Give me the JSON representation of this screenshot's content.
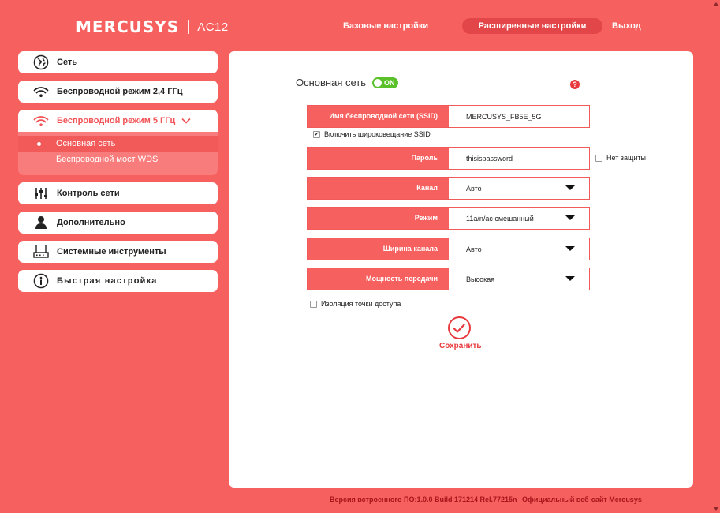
{
  "header": {
    "brand": "MERCUSYS",
    "model": "AC12",
    "nav": {
      "basic": "Базовые настройки",
      "advanced": "Расширенные настройки",
      "exit": "Выход"
    }
  },
  "sidebar": {
    "items": [
      {
        "label": "Сеть",
        "icon": "globe-icon"
      },
      {
        "label": "Беспроводной режим 2,4 ГГц",
        "icon": "wifi-icon"
      },
      {
        "label": "Беспроводной режим 5 ГГц",
        "icon": "wifi-icon"
      },
      {
        "label": "Контроль сети",
        "icon": "sliders-icon"
      },
      {
        "label": "Дополнительно",
        "icon": "user-icon"
      },
      {
        "label": "Системные инструменты",
        "icon": "router-icon"
      },
      {
        "label": "Быстрая настройка",
        "icon": "info-icon"
      }
    ],
    "submenu": [
      {
        "label": "Основная сеть"
      },
      {
        "label": "Беспроводной мост WDS"
      }
    ]
  },
  "main": {
    "section_title": "Основная сеть",
    "toggle_label": "ON",
    "help_glyph": "?",
    "ssid": {
      "label": "Имя беспроводной сети (SSID)",
      "value": "MERCUSYS_FB5E_5G"
    },
    "broadcast_ssid": {
      "label": "Включить широковещание SSID",
      "checked": true
    },
    "password": {
      "label": "Пароль",
      "value": "thisispassword"
    },
    "no_security": {
      "label": "Нет защиты",
      "checked": false
    },
    "channel": {
      "label": "Канал",
      "value": "Авто"
    },
    "mode": {
      "label": "Режим",
      "value": "11a/n/ac смешанный"
    },
    "width": {
      "label": "Ширина канала",
      "value": "Авто"
    },
    "power": {
      "label": "Мощность передачи",
      "value": "Высокая"
    },
    "ap_isolation": {
      "label": "Изоляция точки доступа",
      "checked": false
    },
    "save_label": "Сохранить"
  },
  "footer": {
    "firmware": "Версия встроенного ПО:1.0.0 Build 171214 Rel.77215n",
    "website": "Официальный веб-сайт Mercusys"
  },
  "colors": {
    "background": "#f6605f",
    "accent": "#e8393c",
    "toggle_on": "#5ac12a",
    "panel": "#ffffff"
  }
}
